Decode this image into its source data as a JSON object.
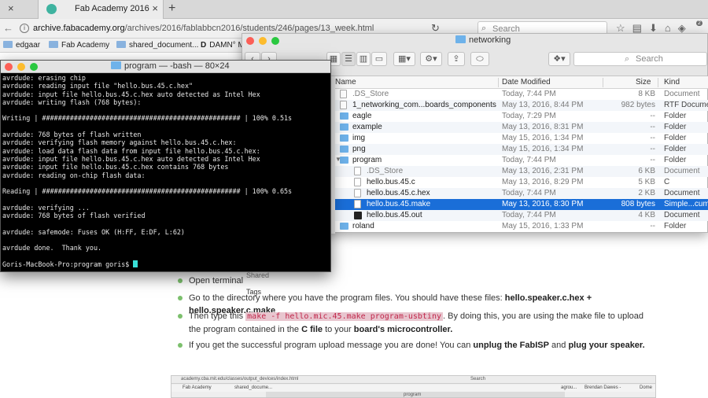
{
  "browser": {
    "tab_title": "Fab Academy 2016",
    "url_host": "archive.fabacademy.org",
    "url_path": "/archives/2016/fablabbcn2016/students/246/pages/13_week.html",
    "search_placeholder": "Search",
    "badge_count": "2",
    "bookmarks": [
      "edgaar",
      "Fab Academy",
      "shared_document...",
      "DAMN° M"
    ]
  },
  "page": {
    "bullet1_a": "Open terminal",
    "bullet2_a": "Go to the directory where you have the program files. You should have these files:",
    "bullet2_b": "hello.speaker.c.hex + hello.speaker.c.make",
    "bullet3_a": "Then type this",
    "bullet3_code": "make -f hello.mic.45.make program-usbtiny",
    "bullet3_b": ". By doing this, you are using the make file to upload the program contained in the",
    "bullet3_c": "C file",
    "bullet3_d": "to your",
    "bullet3_e": "board's microcontroller.",
    "bullet4_a": "If you get the successful program upload message you are done! You can",
    "bullet4_b": "unplug the FabISP",
    "bullet4_c": "and",
    "bullet4_d": "plug your speaker.",
    "thumb_url": "academy.cba.mit.edu/classes/output_devices/index.html",
    "thumb_search": "Search",
    "thumb_bm1": "Fab Academy",
    "thumb_bm2": "shared_docume...",
    "thumb_bm3": "agrou...",
    "thumb_bm4": "Brendan Dawes -",
    "thumb_bm5": "Dome",
    "thumb_tab": "program"
  },
  "finder": {
    "title": "networking",
    "search_placeholder": "Search",
    "sidebar_shared": "Shared",
    "sidebar_tags": "Tags",
    "columns": {
      "name": "Name",
      "date": "Date Modified",
      "size": "Size",
      "kind": "Kind"
    },
    "rows": [
      {
        "name": ".DS_Store",
        "date": "Today, 7:44 PM",
        "size": "8 KB",
        "kind": "Document",
        "icon": "doc-icon",
        "indent": 0,
        "dim": true
      },
      {
        "name": "1_networking_com...boards_components",
        "date": "May 13, 2016, 8:44 PM",
        "size": "982 bytes",
        "kind": "RTF Document",
        "icon": "doc-icon",
        "indent": 0,
        "dim": false
      },
      {
        "name": "eagle",
        "date": "Today, 7:29 PM",
        "size": "--",
        "kind": "Folder",
        "icon": "folder-icon",
        "indent": 0,
        "dim": false
      },
      {
        "name": "example",
        "date": "May 13, 2016, 8:31 PM",
        "size": "--",
        "kind": "Folder",
        "icon": "folder-icon",
        "indent": 0,
        "dim": false
      },
      {
        "name": "img",
        "date": "May 15, 2016, 1:34 PM",
        "size": "--",
        "kind": "Folder",
        "icon": "folder-icon",
        "indent": 0,
        "dim": false
      },
      {
        "name": "png",
        "date": "May 15, 2016, 1:34 PM",
        "size": "--",
        "kind": "Folder",
        "icon": "folder-icon",
        "indent": 0,
        "dim": false
      },
      {
        "name": "program",
        "date": "Today, 7:44 PM",
        "size": "--",
        "kind": "Folder",
        "icon": "folder-icon",
        "indent": 0,
        "dim": false
      },
      {
        "name": ".DS_Store",
        "date": "May 13, 2016, 2:31 PM",
        "size": "6 KB",
        "kind": "Document",
        "icon": "doc-icon",
        "indent": 1,
        "dim": true
      },
      {
        "name": "hello.bus.45.c",
        "date": "May 13, 2016, 8:29 PM",
        "size": "5 KB",
        "kind": "C",
        "icon": "doc-icon",
        "indent": 1,
        "dim": false
      },
      {
        "name": "hello.bus.45.c.hex",
        "date": "Today, 7:44 PM",
        "size": "2 KB",
        "kind": "Document",
        "icon": "doc-icon",
        "indent": 1,
        "dim": false
      },
      {
        "name": "hello.bus.45.make",
        "date": "May 13, 2016, 8:30 PM",
        "size": "808 bytes",
        "kind": "Simple...cument",
        "icon": "doc-icon",
        "indent": 1,
        "dim": false,
        "selected": true
      },
      {
        "name": "hello.bus.45.out",
        "date": "Today, 7:44 PM",
        "size": "4 KB",
        "kind": "Document",
        "icon": "exec-icon",
        "indent": 1,
        "dim": false
      },
      {
        "name": "roland",
        "date": "May 15, 2016, 1:33 PM",
        "size": "--",
        "kind": "Folder",
        "icon": "folder-icon",
        "indent": 0,
        "dim": false
      }
    ]
  },
  "terminal": {
    "title": "program — -bash — 80×24",
    "lines": [
      "avrdude: erasing chip",
      "avrdude: reading input file \"hello.bus.45.c.hex\"",
      "avrdude: input file hello.bus.45.c.hex auto detected as Intel Hex",
      "avrdude: writing flash (768 bytes):",
      "",
      "Writing | ################################################## | 100% 0.51s",
      "",
      "avrdude: 768 bytes of flash written",
      "avrdude: verifying flash memory against hello.bus.45.c.hex:",
      "avrdude: load data flash data from input file hello.bus.45.c.hex:",
      "avrdude: input file hello.bus.45.c.hex auto detected as Intel Hex",
      "avrdude: input file hello.bus.45.c.hex contains 768 bytes",
      "avrdude: reading on-chip flash data:",
      "",
      "Reading | ################################################## | 100% 0.65s",
      "",
      "avrdude: verifying ...",
      "avrdude: 768 bytes of flash verified",
      "",
      "avrdude: safemode: Fuses OK (H:FF, E:DF, L:62)",
      "",
      "avrdude done.  Thank you.",
      ""
    ],
    "prompt": "Goris-MacBook-Pro:program goris$ "
  }
}
